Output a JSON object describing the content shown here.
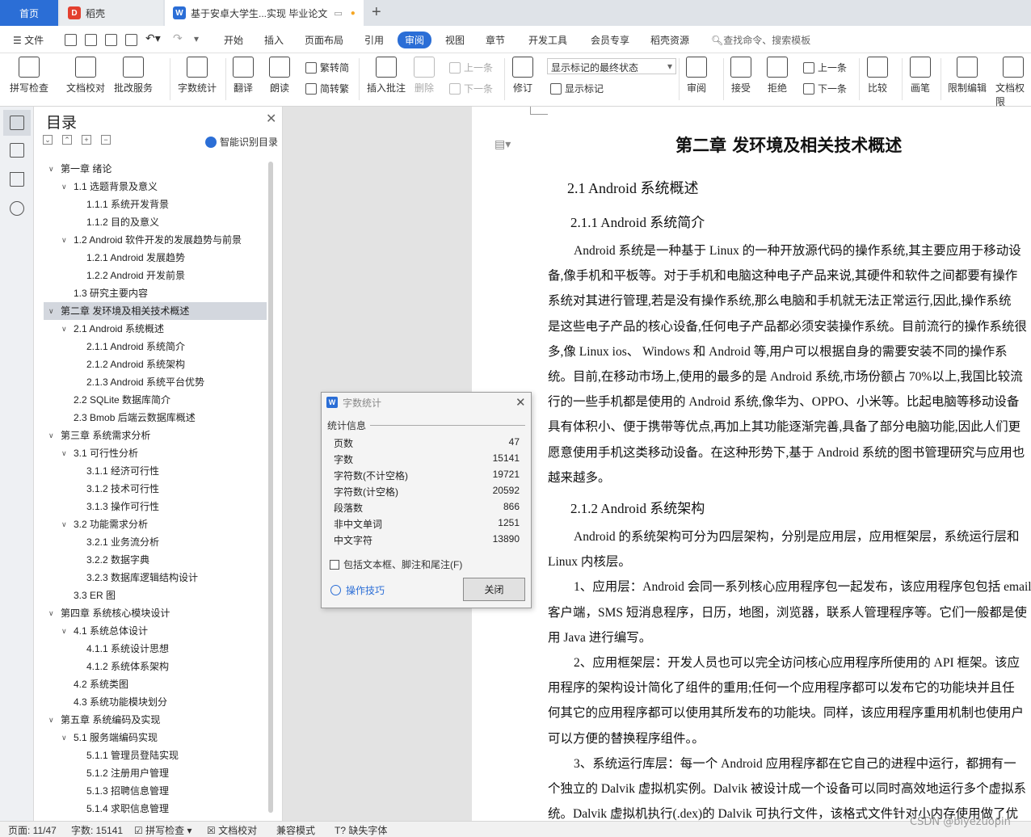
{
  "tabs": {
    "home": "首页",
    "daoke": "稻壳",
    "doc": "基于安卓大学生...实现 毕业论文"
  },
  "menu": {
    "file": "文件",
    "items": [
      "开始",
      "插入",
      "页面布局",
      "引用",
      "审阅",
      "视图",
      "章节",
      "开发工具",
      "会员专享",
      "稻壳资源"
    ],
    "active": "审阅",
    "search": "查找命令、搜索模板"
  },
  "ribbon": {
    "spell": "拼写检查",
    "doc_check": "文档校对",
    "batch": "批改服务",
    "wordcount": "字数统计",
    "translate": "翻译",
    "read": "朗读",
    "to_trad": "繁转简",
    "to_simp": "简转繁",
    "insert_comment": "插入批注",
    "delete": "删除",
    "prev_comment": "上一条",
    "next_comment": "下一条",
    "revise": "修订",
    "markup_state": "显示标记的最终状态",
    "show_markup": "显示标记",
    "review": "审阅",
    "accept": "接受",
    "reject": "拒绝",
    "prev": "上一条",
    "next": "下一条",
    "compare": "比较",
    "pen": "画笔",
    "restrict": "限制编辑",
    "doc_perm": "文档权限"
  },
  "toc": {
    "title": "目录",
    "smart": "智能识别目录",
    "items": [
      {
        "text": "第一章 绪论",
        "level": 0,
        "arrow": "open"
      },
      {
        "text": "1.1 选题背景及意义",
        "level": 1,
        "arrow": "open"
      },
      {
        "text": "1.1.1 系统开发背景",
        "level": 2,
        "arrow": ""
      },
      {
        "text": "1.1.2 目的及意义",
        "level": 2,
        "arrow": ""
      },
      {
        "text": "1.2 Android 软件开发的发展趋势与前景",
        "level": 1,
        "arrow": "open"
      },
      {
        "text": "1.2.1 Android 发展趋势",
        "level": 2,
        "arrow": ""
      },
      {
        "text": "1.2.2 Android 开发前景",
        "level": 2,
        "arrow": ""
      },
      {
        "text": "1.3 研究主要内容",
        "level": 1,
        "arrow": ""
      },
      {
        "text": "第二章 发环境及相关技术概述",
        "level": 0,
        "arrow": "open",
        "selected": true
      },
      {
        "text": "2.1 Android 系统概述",
        "level": 1,
        "arrow": "open"
      },
      {
        "text": "2.1.1 Android 系统简介",
        "level": 2,
        "arrow": ""
      },
      {
        "text": "2.1.2 Android 系统架构",
        "level": 2,
        "arrow": ""
      },
      {
        "text": "2.1.3 Android 系统平台优势",
        "level": 2,
        "arrow": ""
      },
      {
        "text": "2.2 SQLite 数据库简介",
        "level": 1,
        "arrow": ""
      },
      {
        "text": "2.3 Bmob 后端云数据库概述",
        "level": 1,
        "arrow": ""
      },
      {
        "text": "第三章 系统需求分析",
        "level": 0,
        "arrow": "open"
      },
      {
        "text": "3.1 可行性分析",
        "level": 1,
        "arrow": "open"
      },
      {
        "text": "3.1.1 经济可行性",
        "level": 2,
        "arrow": ""
      },
      {
        "text": "3.1.2 技术可行性",
        "level": 2,
        "arrow": ""
      },
      {
        "text": "3.1.3 操作可行性",
        "level": 2,
        "arrow": ""
      },
      {
        "text": "3.2 功能需求分析",
        "level": 1,
        "arrow": "open"
      },
      {
        "text": "3.2.1 业务流分析",
        "level": 2,
        "arrow": ""
      },
      {
        "text": "3.2.2 数据字典",
        "level": 2,
        "arrow": ""
      },
      {
        "text": "3.2.3 数据库逻辑结构设计",
        "level": 2,
        "arrow": ""
      },
      {
        "text": "3.3 ER 图",
        "level": 1,
        "arrow": ""
      },
      {
        "text": "第四章 系统核心模块设计",
        "level": 0,
        "arrow": "open"
      },
      {
        "text": "4.1 系统总体设计",
        "level": 1,
        "arrow": "open"
      },
      {
        "text": "4.1.1 系统设计思想",
        "level": 2,
        "arrow": ""
      },
      {
        "text": "4.1.2 系统体系架构",
        "level": 2,
        "arrow": ""
      },
      {
        "text": "4.2 系统类图",
        "level": 1,
        "arrow": ""
      },
      {
        "text": "4.3 系统功能模块划分",
        "level": 1,
        "arrow": ""
      },
      {
        "text": "第五章 系统编码及实现",
        "level": 0,
        "arrow": "open"
      },
      {
        "text": "5.1 服务端编码实现",
        "level": 1,
        "arrow": "open"
      },
      {
        "text": "5.1.1 管理员登陆实现",
        "level": 2,
        "arrow": ""
      },
      {
        "text": "5.1.2 注册用户管理",
        "level": 2,
        "arrow": ""
      },
      {
        "text": "5.1.3 招聘信息管理",
        "level": 2,
        "arrow": ""
      },
      {
        "text": "5.1.4 求职信息管理",
        "level": 2,
        "arrow": ""
      }
    ]
  },
  "dialog": {
    "title": "字数统计",
    "section": "统计信息",
    "stats": [
      {
        "label": "页数",
        "value": "47"
      },
      {
        "label": "字数",
        "value": "15141"
      },
      {
        "label": "字符数(不计空格)",
        "value": "19721"
      },
      {
        "label": "字符数(计空格)",
        "value": "20592"
      },
      {
        "label": "段落数",
        "value": "866"
      },
      {
        "label": "非中文单词",
        "value": "1251"
      },
      {
        "label": "中文字符",
        "value": "13890"
      }
    ],
    "checkbox": "包括文本框、脚注和尾注(F)",
    "tips": "操作技巧",
    "close": "关闭"
  },
  "doc": {
    "chapter": "第二章  发环境及相关技术概述",
    "h21": "2.1 Android 系统概述",
    "h211": "2.1.1 Android 系统简介",
    "h212": "2.1.2 Android 系统架构",
    "lines_a": [
      "Android 系统是一种基于 Linux 的一种开放源代码的操作系统,其主要应用于移动设",
      "备,像手机和平板等。对于手机和电脑这种电子产品来说,其硬件和软件之间都要有操作",
      "系统对其进行管理,若是没有操作系统,那么电脑和手机就无法正常运行,因此,操作系统",
      "是这些电子产品的核心设备,任何电子产品都必须安装操作系统。目前流行的操作系统很",
      "多,像 Linux  ios、  Windows 和  Android 等,用户可以根据自身的需要安装不同的操作系",
      "统。目前,在移动市场上,使用的最多的是  Android 系统,市场份额占 70%以上,我国比较流",
      "行的一些手机都是使用的 Android 系统,像华为、OPPO、小米等。比起电脑等移动设备",
      "具有体积小、便于携带等优点,再加上其功能逐渐完善,具备了部分电脑功能,因此人们更",
      "愿意使用手机这类移动设备。在这种形势下,基于 Android 系统的图书管理研究与应用也",
      "越来越多。"
    ],
    "lines_b": [
      "Android 的系统架构可分为四层架构，分别是应用层，应用框架层，系统运行层和",
      "Linux 内核层。",
      "1、应用层：Android 会同一系列核心应用程序包一起发布，该应用程序包包括 email",
      "客户端，SMS 短消息程序，日历，地图，浏览器，联系人管理程序等。它们一般都是使",
      "用 Java 进行编写。",
      "2、应用框架层：开发人员也可以完全访问核心应用程序所使用的 API 框架。该应",
      "用程序的架构设计简化了组件的重用;任何一个应用程序都可以发布它的功能块并且任",
      "何其它的应用程序都可以使用其所发布的功能块。同样，该应用程序重用机制也使用户",
      "可以方便的替换程序组件。。",
      "3、系统运行库层：每一个 Android 应用程序都在它自己的进程中运行，都拥有一",
      "个独立的 Dalvik 虚拟机实例。Dalvik 被设计成一个设备可以同时高效地运行多个虚拟系",
      "统。Dalvik 虚拟机执行(.dex)的 Dalvik 可执行文件，该格式文件针对小内存使用做了优"
    ]
  },
  "status": {
    "page": "页面: 11/47",
    "words": "字数: 15141",
    "spell": "拼写检查",
    "doccheck": "文档校对",
    "compat": "兼容模式",
    "font": "缺失字体"
  },
  "watermark": "CSDN @biyezuopin"
}
